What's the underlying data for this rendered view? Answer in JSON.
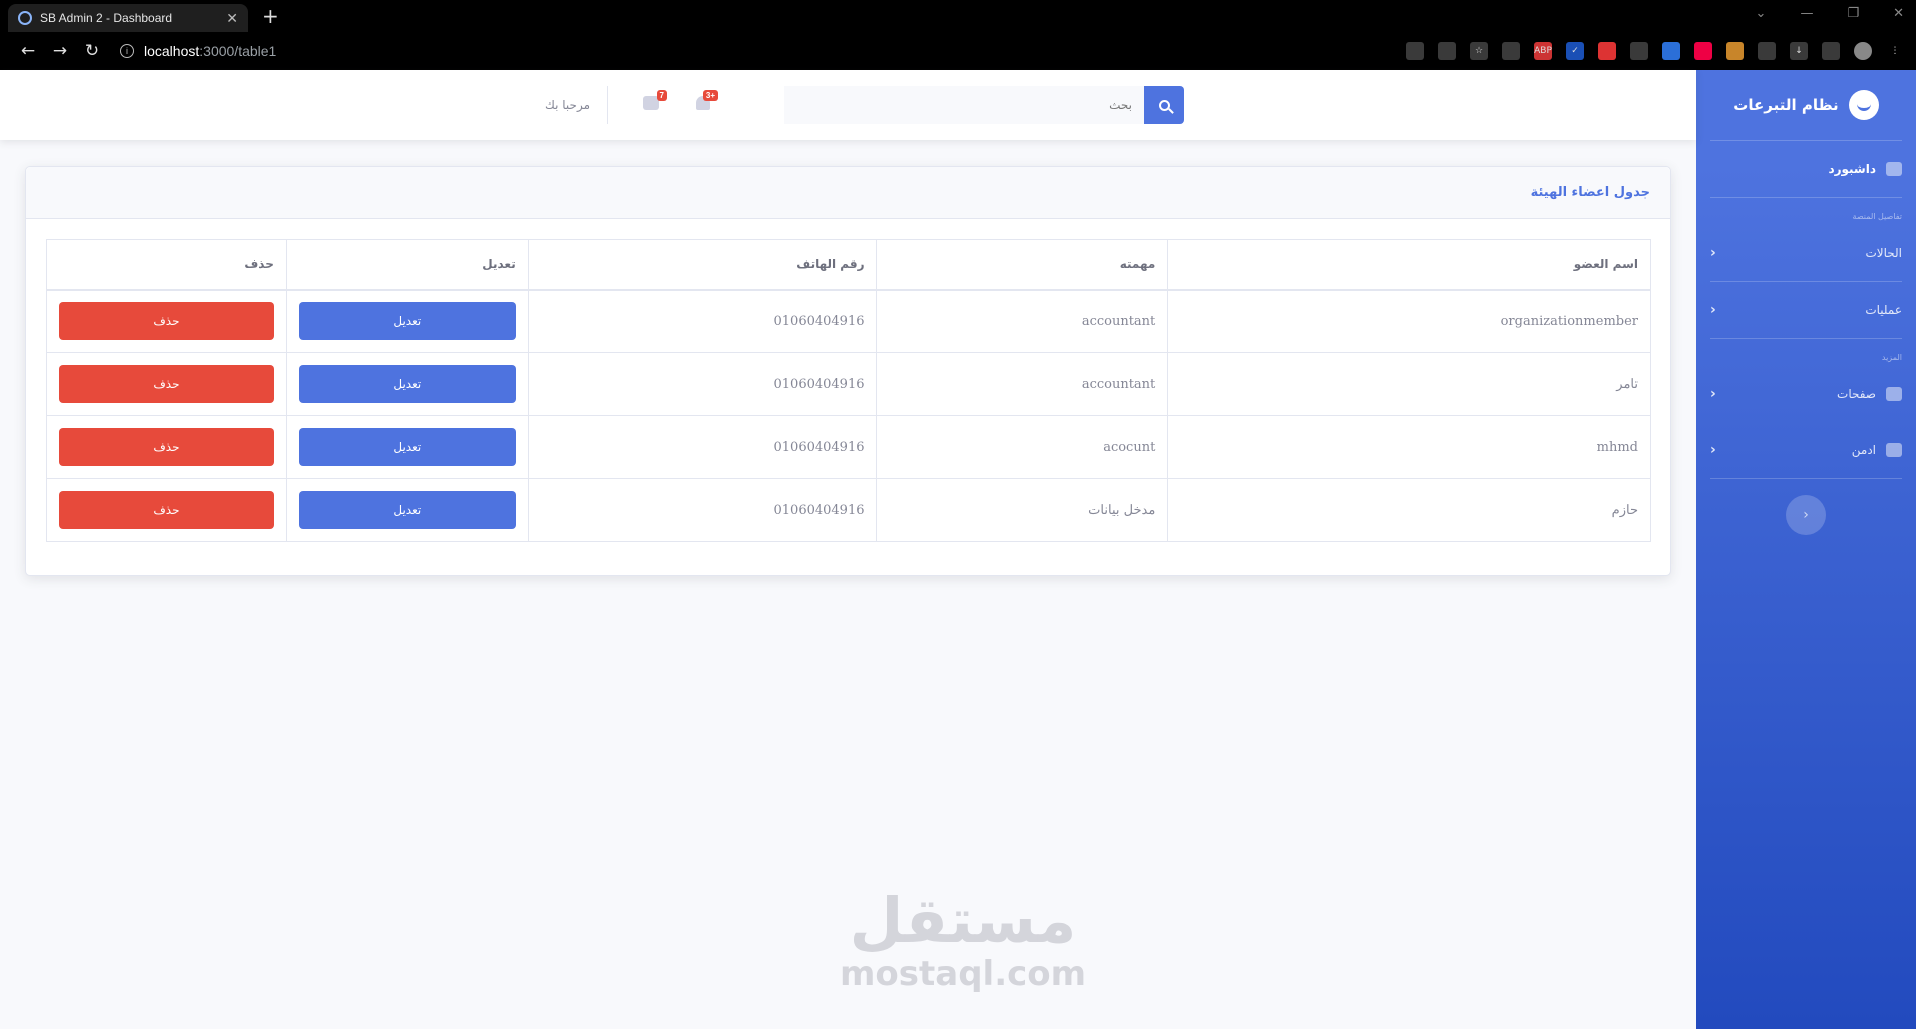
{
  "browser": {
    "tab_title": "SB Admin 2 - Dashboard",
    "url_host": "localhost",
    "url_path": ":3000/table1",
    "extensions": [
      "ABP"
    ]
  },
  "sidebar": {
    "brand": "نظام التبرعات",
    "dashboard": "داشبورد",
    "heading1": "تفاصيل المنصة",
    "items1": [
      {
        "label": "الحالات"
      },
      {
        "label": "عمليات"
      }
    ],
    "heading2": "المزيد",
    "items2": [
      {
        "label": "صفحات"
      },
      {
        "label": "ادمن"
      }
    ],
    "toggle": "‹"
  },
  "topbar": {
    "search_placeholder": "بحث",
    "alerts_count": "3+",
    "messages_count": "7",
    "greeting": "مرحبا بك"
  },
  "card": {
    "title": "جدول اعضاء الهيئة",
    "columns": [
      "اسم العضو",
      "مهمته",
      "رقم الهاتف",
      "تعديل",
      "حذف"
    ],
    "edit_label": "تعديل",
    "delete_label": "حذف",
    "rows": [
      {
        "name": "organizationmember",
        "role": "accountant",
        "phone": "01060404916"
      },
      {
        "name": "تامر",
        "role": "accountant",
        "phone": "01060404916"
      },
      {
        "name": "mhmd",
        "role": "acocunt",
        "phone": "01060404916"
      },
      {
        "name": "حازم",
        "role": "مدخل بيانات",
        "phone": "01060404916"
      }
    ]
  },
  "watermark": {
    "arabic": "مستقل",
    "latin": "mostaql.com"
  },
  "colors": {
    "primary": "#4e73df",
    "danger": "#e74a3b",
    "sidebar_end": "#224abe"
  }
}
